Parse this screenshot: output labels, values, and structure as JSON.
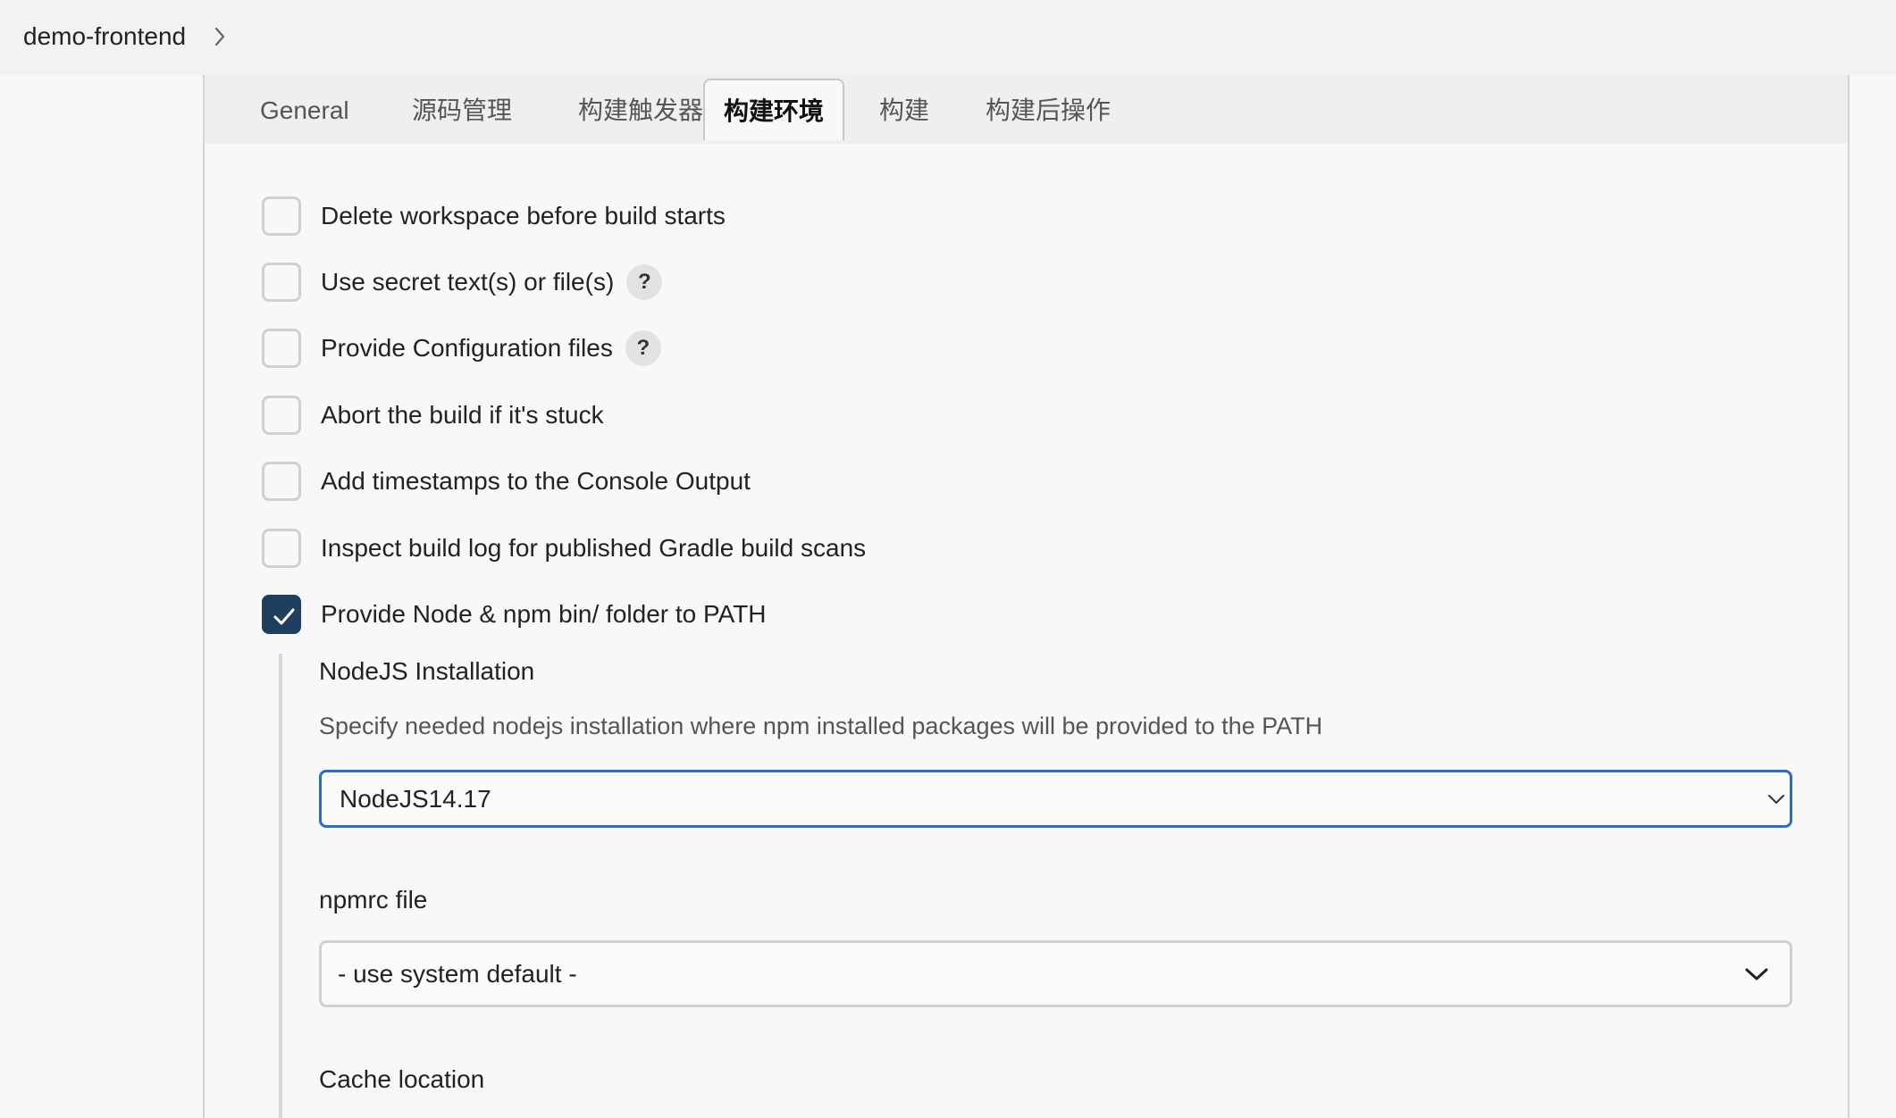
{
  "breadcrumb": {
    "project": "demo-frontend"
  },
  "tabs": [
    {
      "label": "General"
    },
    {
      "label": "源码管理"
    },
    {
      "label": "构建触发器"
    },
    {
      "label": "构建环境"
    },
    {
      "label": "构建"
    },
    {
      "label": "构建后操作"
    }
  ],
  "active_tab": "构建环境",
  "options": [
    {
      "label": "Delete workspace before build starts",
      "checked": false,
      "help": false
    },
    {
      "label": "Use secret text(s) or file(s)",
      "checked": false,
      "help": true
    },
    {
      "label": "Provide Configuration files",
      "checked": false,
      "help": true
    },
    {
      "label": "Abort the build if it's stuck",
      "checked": false,
      "help": false
    },
    {
      "label": "Add timestamps to the Console Output",
      "checked": false,
      "help": false
    },
    {
      "label": "Inspect build log for published Gradle build scans",
      "checked": false,
      "help": false
    },
    {
      "label": "Provide Node & npm bin/ folder to PATH",
      "checked": true,
      "help": false
    }
  ],
  "help_glyph": "?",
  "nodejs": {
    "title": "NodeJS Installation",
    "description": "Specify needed nodejs installation where npm installed packages will be provided to the PATH",
    "selected": "NodeJS14.17"
  },
  "npmrc": {
    "title": "npmrc file",
    "selected": "- use system default -"
  },
  "cache": {
    "title": "Cache location"
  },
  "colors": {
    "checked_fill": "#1f3e60",
    "focus_border": "#2b6cc4"
  }
}
